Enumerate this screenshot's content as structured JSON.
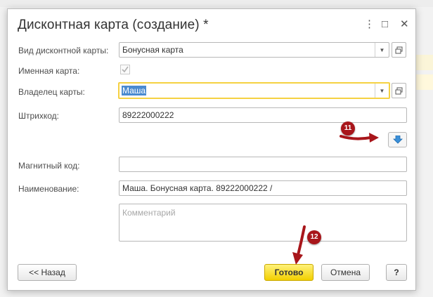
{
  "window": {
    "title": "Дисконтная карта (создание) *",
    "controls": {
      "menu": "⋮",
      "maximize": "□",
      "close": "✕"
    }
  },
  "form": {
    "card_type": {
      "label": "Вид дисконтной карты:",
      "value": "Бонусная карта"
    },
    "named_card": {
      "label": "Именная карта:",
      "checked": true
    },
    "owner": {
      "label": "Владелец карты:",
      "value": "Маша"
    },
    "barcode": {
      "label": "Штрихкод:",
      "value": "89222000222"
    },
    "magnetic_code": {
      "label": "Магнитный код:",
      "value": ""
    },
    "name": {
      "label": "Наименование:",
      "value": "Маша. Бонусная карта. 89222000222 /"
    },
    "comment": {
      "placeholder": "Комментарий",
      "value": ""
    }
  },
  "buttons": {
    "back": "<< Назад",
    "done": "Готово",
    "cancel": "Отмена",
    "help": "?"
  },
  "annotations": {
    "step_11": "11",
    "step_12": "12",
    "color": "#a8161b"
  },
  "icons": {
    "dropdown": "triangle-down",
    "open": "open-in-window",
    "download": "arrow-down-blue",
    "check": "checkmark"
  }
}
